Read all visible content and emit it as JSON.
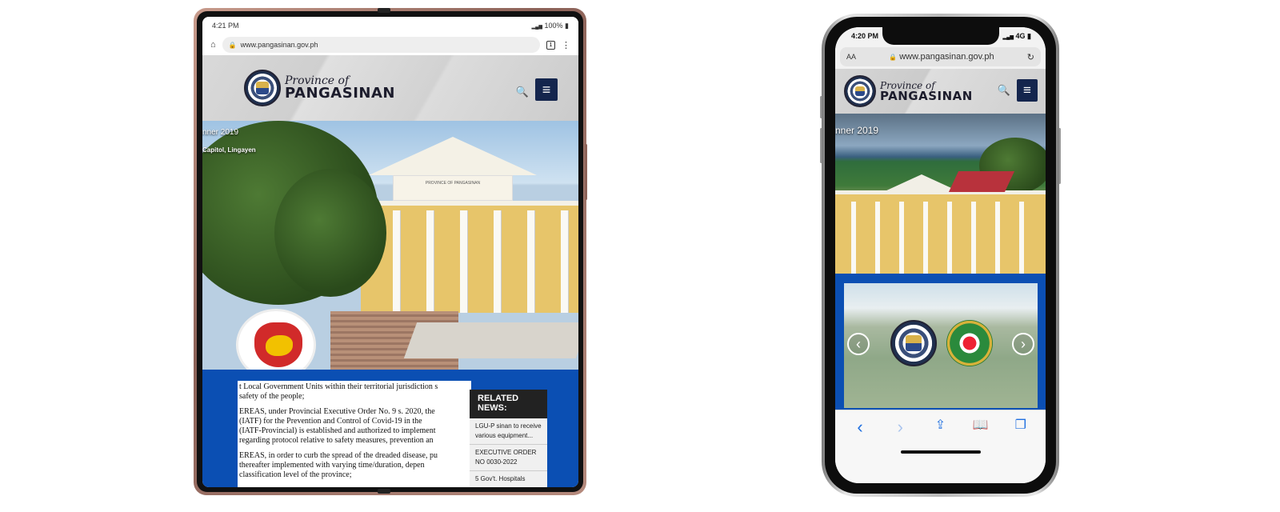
{
  "tablet": {
    "status_time": "4:21 PM",
    "status_battery": "100%",
    "url": "www.pangasinan.gov.ph",
    "tab_count": "1",
    "brand_top": "Province of",
    "brand_bottom": "PANGASINAN",
    "hero_caption_1": "nner 2019",
    "hero_caption_2": "Capitol, Lingayen",
    "frieze_text": "PROVINCE OF PANGASINAN",
    "doc_lines": [
      "t Local Government Units within their territorial jurisdiction s",
      "safety of the people;",
      "EREAS, under Provincial Executive Order No. 9 s. 2020, the",
      "(IATF) for the Prevention and Control of Covid-19 in the",
      "(IATF-Provincial) is established and authorized to implement",
      "regarding protocol relative to safety measures, prevention an",
      "EREAS, in order to curb the spread of the dreaded disease, pu",
      "thereafter implemented with varying time/duration, depen",
      "classification level of the province;"
    ],
    "related_heading": "RELATED NEWS:",
    "related_items": [
      "LGU-P sinan to receive various equipment...",
      "EXECUTIVE ORDER NO 0030-2022",
      "5 Gov't. Hospitals"
    ]
  },
  "phone": {
    "status_time": "4:20 PM",
    "network": "4G",
    "text_size_label": "AA",
    "url": "www.pangasinan.gov.ph",
    "brand_top": "Province of",
    "brand_bottom": "PANGASINAN",
    "hero_caption": "nner 2019",
    "toolbar": {
      "back": "‹",
      "forward": "›",
      "share": "⇪",
      "bookmarks": "📖",
      "tabs": "❐"
    }
  },
  "icons": {
    "home": "⌂",
    "lock": "🔒",
    "kebab": "⋮",
    "search": "🔍",
    "menu": "≡",
    "reload": "↻",
    "prev": "‹",
    "next": "›",
    "signal": "▂▄▆",
    "battery": "▮"
  },
  "colors": {
    "brand_navy": "#14254d",
    "section_blue": "#0b4fb3",
    "ios_blue": "#1f6fe0"
  }
}
